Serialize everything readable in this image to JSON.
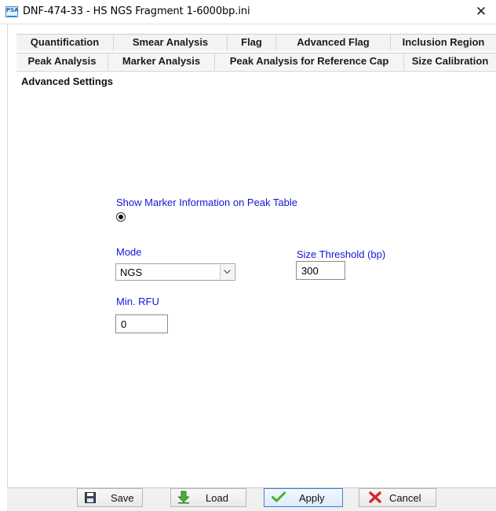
{
  "window": {
    "title": "DNF-474-33 - HS NGS Fragment 1-6000bp.ini",
    "app_icon_text": "PSA",
    "close_glyph": "✕"
  },
  "tabs": {
    "row1": [
      "Quantification",
      "Smear Analysis",
      "Flag",
      "Advanced Flag",
      "Inclusion Region"
    ],
    "row2": [
      "Peak Analysis",
      "Marker Analysis",
      "Peak Analysis for Reference Cap",
      "Size Calibration"
    ]
  },
  "section": {
    "title": "Advanced Settings"
  },
  "settings": {
    "show_marker_label": "Show Marker Information on Peak Table",
    "show_marker_selected": true,
    "mode_label": "Mode",
    "mode_value": "NGS",
    "size_threshold_label": "Size Threshold (bp)",
    "size_threshold_value": "300",
    "min_rfu_label": "Min. RFU",
    "min_rfu_value": "0"
  },
  "buttons": {
    "save": "Save",
    "load": "Load",
    "apply": "Apply",
    "cancel": "Cancel"
  },
  "colors": {
    "field_label": "#1515d8",
    "apply_border": "#3a7fd6",
    "cancel_icon": "#d42a2a",
    "load_icon": "#3aa53a",
    "apply_check": "#4caf2a"
  }
}
